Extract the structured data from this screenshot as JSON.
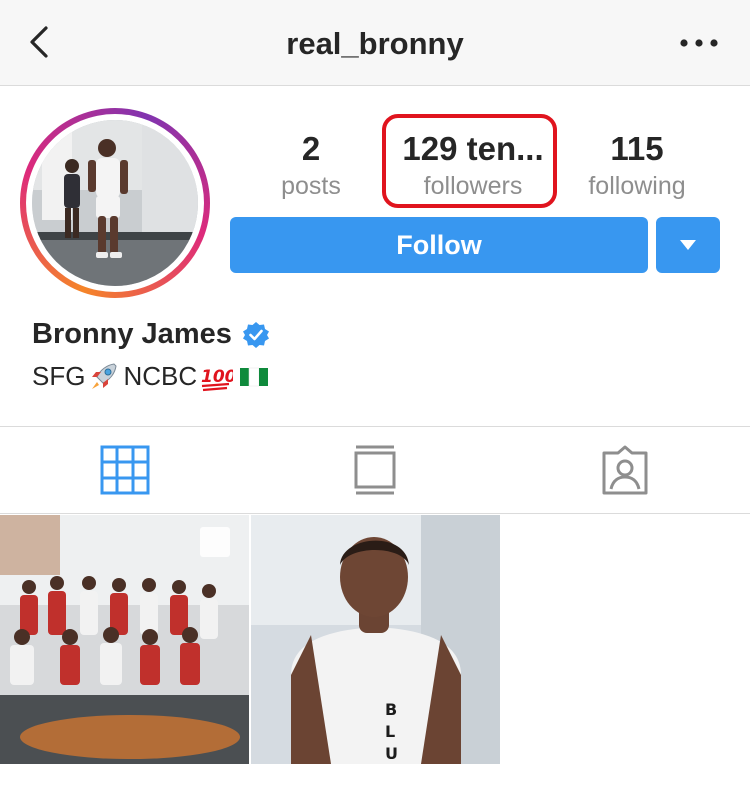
{
  "header": {
    "username": "real_bronny",
    "back_icon": "chevron-left-icon",
    "more_icon": "ellipsis-icon"
  },
  "profile": {
    "stats": [
      {
        "value": "2",
        "label": "posts"
      },
      {
        "value": "129 ten...",
        "label": "followers"
      },
      {
        "value": "115",
        "label": "following"
      }
    ],
    "follow_label": "Follow",
    "display_name": "Bronny James",
    "verified": true,
    "bio_parts": [
      "SFG",
      "NCBC"
    ],
    "bio_emoji": [
      "rocket-emoji",
      "hundred-points-emoji",
      "nigeria-flag-emoji"
    ]
  },
  "tabs": [
    "grid-icon",
    "feed-icon",
    "tagged-icon"
  ],
  "colors": {
    "accent": "#3897f0",
    "highlight_border": "#e0141e",
    "muted_text": "#8e8e8e",
    "text": "#262626"
  }
}
